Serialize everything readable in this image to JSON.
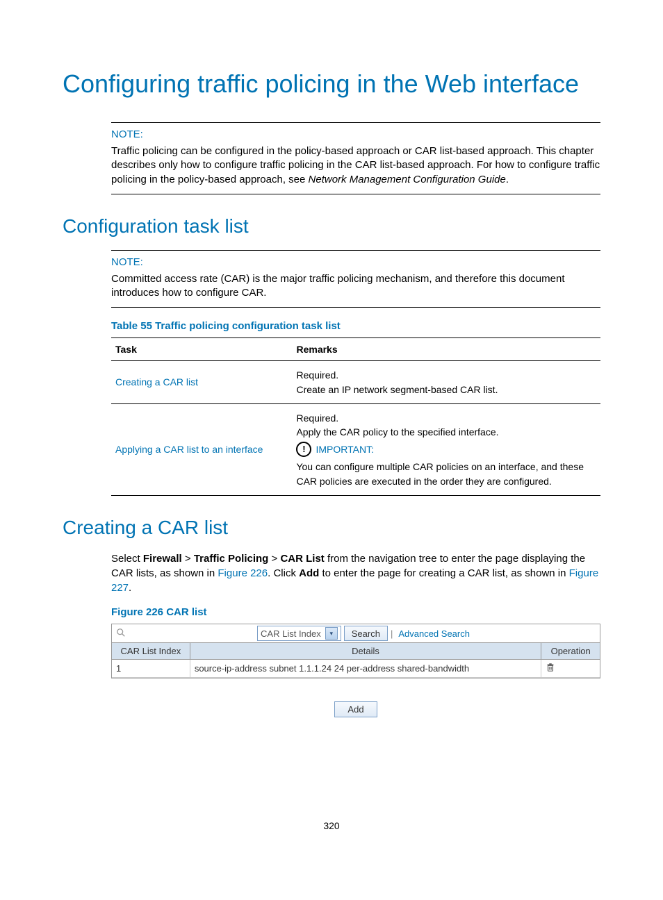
{
  "title": "Configuring traffic policing in the Web interface",
  "note1": {
    "label": "NOTE:",
    "text_pre": "Traffic policing can be configured in the policy-based approach or CAR list-based approach. This chapter describes only how to configure traffic policing in the CAR list-based approach. For how to configure traffic policing in the policy-based approach, see ",
    "text_em": "Network Management Configuration Guide",
    "text_post": "."
  },
  "section1": "Configuration task list",
  "note2": {
    "label": "NOTE:",
    "text": "Committed access rate (CAR) is the major traffic policing mechanism, and therefore this document introduces how to configure CAR."
  },
  "table55": {
    "caption": "Table 55 Traffic policing configuration task list",
    "head_task": "Task",
    "head_remarks": "Remarks",
    "row1_task": "Creating a CAR list",
    "row1_r1": "Required.",
    "row1_r2": "Create an IP network segment-based CAR list.",
    "row2_task": "Applying a CAR list to an interface",
    "row2_r1": "Required.",
    "row2_r2": "Apply the CAR policy to the specified interface.",
    "row2_important": "IMPORTANT:",
    "row2_r3": "You can configure multiple CAR policies on an interface, and these CAR policies are executed in the order they are configured."
  },
  "section2": "Creating a CAR list",
  "para": {
    "p1": "Select ",
    "b1": "Firewall",
    "gt1": " > ",
    "b2": "Traffic Policing",
    "gt2": " > ",
    "b3": "CAR List",
    "p2": " from the navigation tree to enter the page displaying the CAR lists, as shown in ",
    "l1": "Figure 226",
    "p3": ". Click ",
    "b4": "Add",
    "p4": " to enter the page for creating a CAR list, as shown in ",
    "l2": "Figure 227",
    "p5": "."
  },
  "figure226": {
    "caption": "Figure 226 CAR list",
    "select_label": "CAR List Index",
    "search_btn": "Search",
    "adv_search": "Advanced Search",
    "th_index": "CAR List Index",
    "th_details": "Details",
    "th_op": "Operation",
    "row_index": "1",
    "row_details": "source-ip-address subnet 1.1.1.24 24 per-address shared-bandwidth",
    "add_btn": "Add"
  },
  "page_number": "320"
}
